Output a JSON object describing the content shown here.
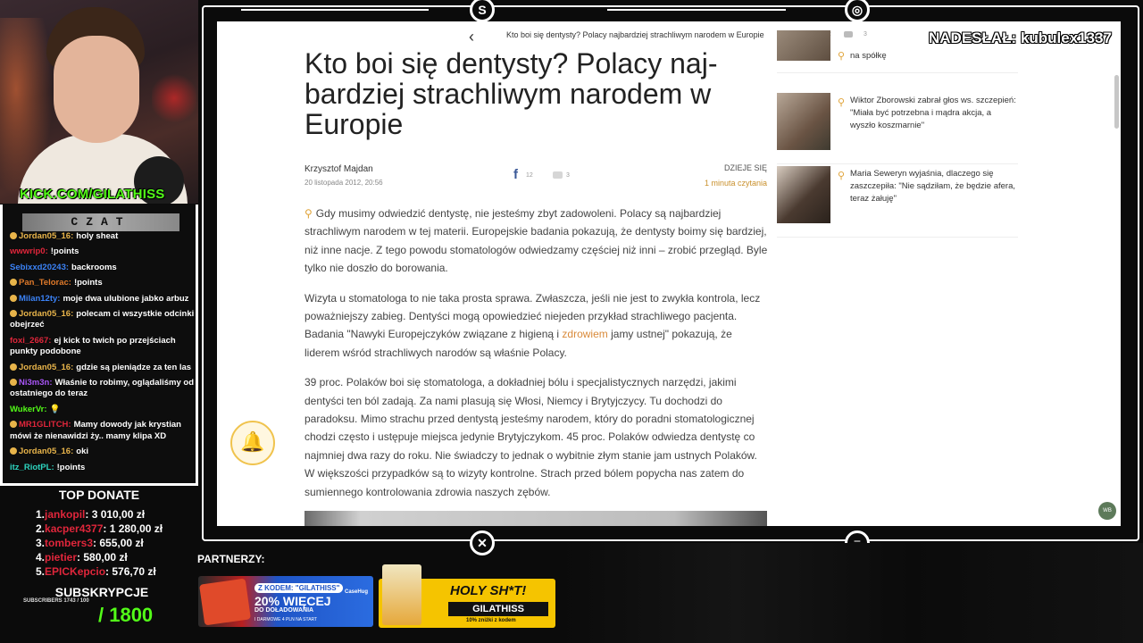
{
  "webcam": {
    "channel_label": "KICK.COM/GILATHISS"
  },
  "chat": {
    "header": "CZAT",
    "messages": [
      {
        "user": "Jordan05_16:",
        "text": "holy sheat",
        "color": "#e8b44a",
        "badge": true
      },
      {
        "user": "wwwrip0:",
        "text": "!points",
        "color": "#e0263b",
        "badge": false
      },
      {
        "user": "Sebixxd20243:",
        "text": "backrooms",
        "color": "#3b82f6",
        "badge": false
      },
      {
        "user": "Pan_Telorac:",
        "text": "!points",
        "color": "#e07a2a",
        "badge": true
      },
      {
        "user": "Milan12ty:",
        "text": "moje dwa ulubione jabko arbuz",
        "color": "#3b82f6",
        "badge": true
      },
      {
        "user": "Jordan05_16:",
        "text": "polecam ci wszystkie odcinki obejrzeć",
        "color": "#e8b44a",
        "badge": true
      },
      {
        "user": "foxi_2667:",
        "text": "ej kick to twich po przejściach punkty podobone",
        "color": "#e0263b",
        "badge": false
      },
      {
        "user": "Jordan05_16:",
        "text": "gdzie są pieniądze za ten las",
        "color": "#e8b44a",
        "badge": true
      },
      {
        "user": "Ni3m3n:",
        "text": "Właśnie to robimy, oglądaliśmy od ostatniego do teraz",
        "color": "#a855f7",
        "badge": true
      },
      {
        "user": "WukerVr:",
        "text": "💡",
        "color": "#53fc18",
        "badge": false
      },
      {
        "user": "MR1GLITCH:",
        "text": "Mamy dowody jak krystian mówi że nienawidzi ży.. mamy klipa XD",
        "color": "#e0263b",
        "badge": true
      },
      {
        "user": "Jordan05_16:",
        "text": "oki",
        "color": "#e8b44a",
        "badge": true
      },
      {
        "user": "itz_RiotPL:",
        "text": "!points",
        "color": "#2dd4bf",
        "badge": false
      }
    ]
  },
  "donate": {
    "title": "TOP DONATE",
    "rows": [
      {
        "rank": "1.",
        "name": "jankopil",
        "amount": ": 3 010,00 zł"
      },
      {
        "rank": "2.",
        "name": "kacper4377",
        "amount": ": 1 280,00 zł"
      },
      {
        "rank": "3.",
        "name": "tombers3",
        "amount": ": 655,00 zł"
      },
      {
        "rank": "4.",
        "name": "pietier",
        "amount": ": 580,00 zł"
      },
      {
        "rank": "5.",
        "name": "EPICKepcio",
        "amount": ": 576,70 zł"
      }
    ]
  },
  "subs": {
    "title": "SUBSKRYPCJE",
    "small": "SUBSCRIBERS 1743 / 100",
    "goal": "/ 1800"
  },
  "overlay": {
    "sender": "NADESŁAŁ: kubulex1337"
  },
  "browser": {
    "topbar": {
      "back": "‹",
      "title": "Kto boi się dentysty? Polacy najbardziej strachliwym narodem w Europie",
      "fb": "f",
      "fb_count": "12",
      "comment_count": "3"
    },
    "headline": "Kto boi się dentysty? Polacy naj-bardziej strachliwym narodem w Europie",
    "author": "Krzysztof Majdan",
    "date": "20 listopada 2012, 20:56",
    "fb": "f",
    "fb_count": "12",
    "comment_count": "3",
    "category": "DZIEJE SIĘ",
    "read_time": "1 minuta czytania",
    "paragraphs": {
      "p1": "Gdy musimy odwiedzić dentystę, nie jesteśmy zbyt zadowoleni. Polacy są najbardziej strachliwym narodem w tej materii. Europejskie badania pokazują, że dentysty boimy się bardziej, niż inne nacje. Z tego powodu stomatologów odwiedzamy częściej niż inni – zrobić przegląd. Byle tylko nie doszło do borowania.",
      "p2a": "Wizyta u stomatologa to nie taka prosta sprawa. Zwłaszcza, jeśli nie jest to zwykła kontrola, lecz poważniejszy zabieg. Dentyści mogą opowiedzieć niejeden przykład strachliwego pacjenta. Badania \"Nawyki Europejczyków związane z higieną i ",
      "p2link": "zdrowiem",
      "p2b": " jamy ustnej\" pokazują, że liderem wśród strachliwych narodów są właśnie Polacy.",
      "p3": "39 proc. Polaków boi się stomatologa, a dokładniej bólu i specjalistycznych narzędzi, jakimi dentyści ten ból zadają. Za nami plasują się Włosi, Niemcy i Brytyjczycy. Tu dochodzi do paradoksu. Mimo strachu przed dentystą jesteśmy narodem, który do poradni stomatologicznej chodzi często i ustępuje miejsca jedynie Brytyjczykom. 45 proc. Polaków odwiedza dentystę co najmniej dwa razy do roku. Nie świadczy to jednak o wybitnie złym stanie jam ustnych Polaków. W większości przypadków są to wizyty kontrolne. Strach przed bólem popycha nas zatem do sumiennego kontrolowania zdrowia naszych zębów."
    },
    "sidebar": [
      {
        "text": "na spółkę",
        "thumb": "#7c6a5a"
      },
      {
        "text": "Wiktor Zborowski zabrał głos ws. szczepień: \"Miała być potrzebna i mądra akcja, a wyszło koszmarnie\"",
        "thumb": "#8a7563"
      },
      {
        "text": "Maria Seweryn wyjaśnia, dlaczego się zaszczepiła: \"Nie sądziłam, że będzie afera, teraz żałuję\"",
        "thumb": "#5b4a40"
      }
    ],
    "wb_button": "WB"
  },
  "partners": {
    "label": "PARTNERZY:",
    "banner1": {
      "code": "Z KODEM: \"GILATHISS\"",
      "brand": "CaseHug",
      "big": "20% WIĘCEJ",
      "sub": "DO DOŁADOWANIA",
      "sub2": "I DARMOWE 4 PLN NA START"
    },
    "banner2": {
      "title": "HOLY SH*T!",
      "code": "GILATHISS",
      "sub": "10% zniżki z kodem"
    }
  }
}
